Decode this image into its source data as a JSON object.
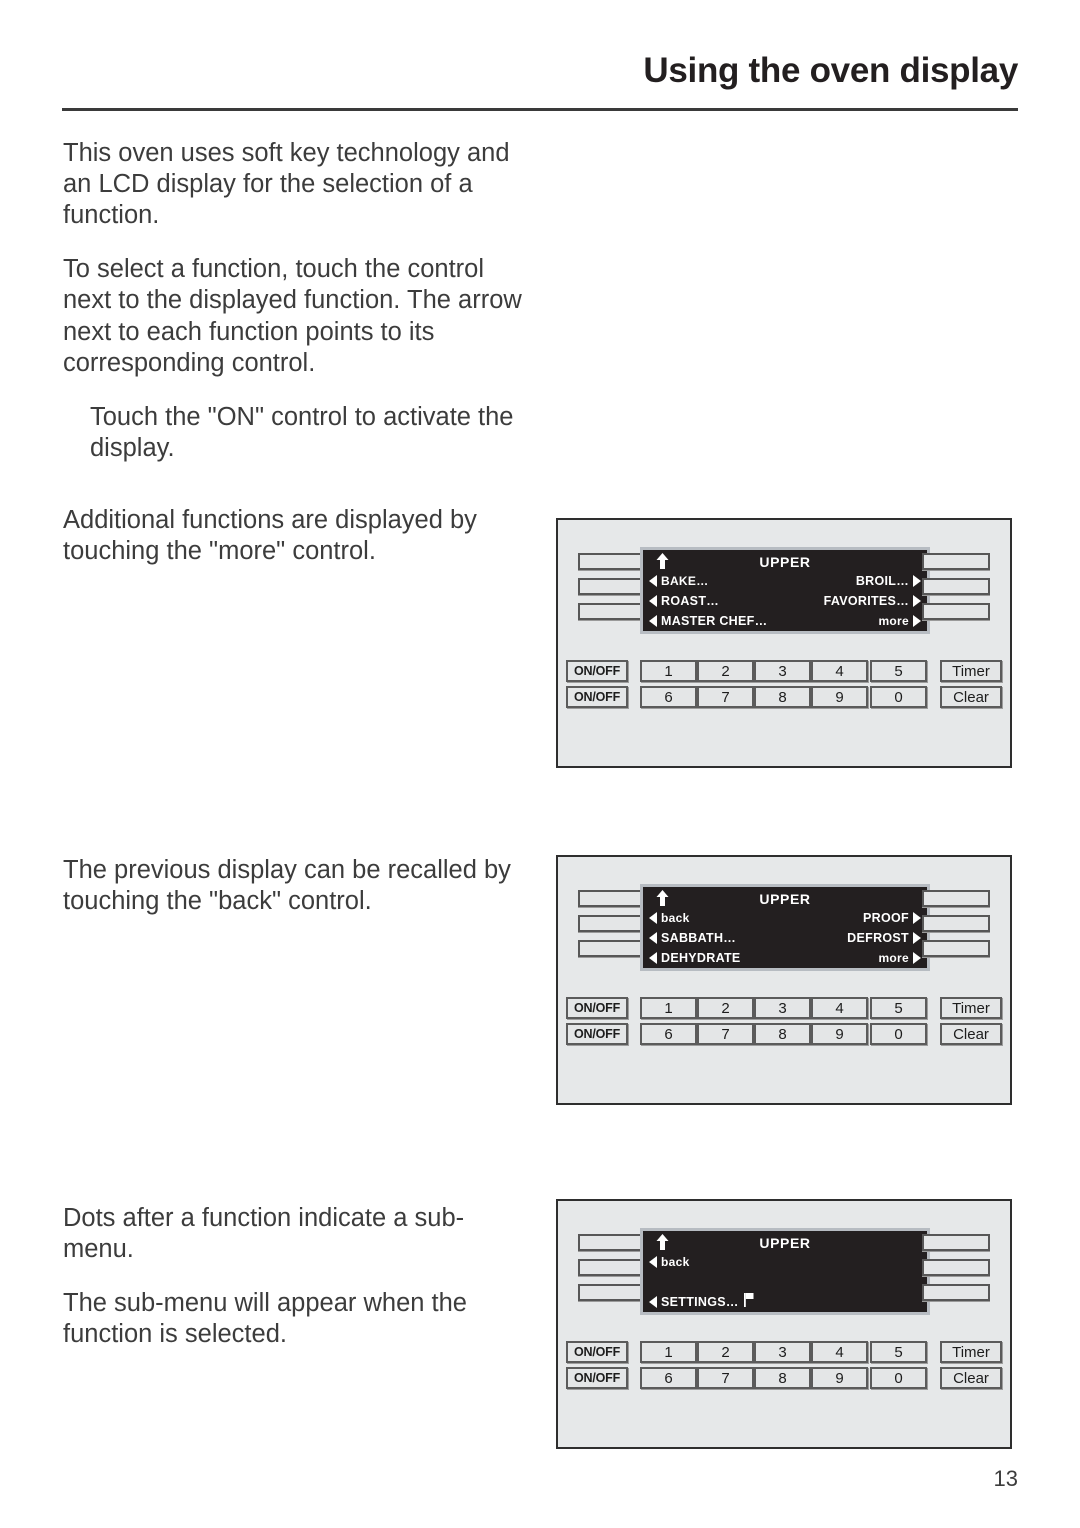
{
  "header": {
    "title": "Using the oven display"
  },
  "body": {
    "intro": [
      "This oven uses soft key technology and an LCD display for the selection of a function.",
      "To select a function, touch the control next to the displayed function. The arrow next to each function points to its corresponding control.",
      "Touch the \"ON\" control to activate the display."
    ],
    "more_note": [
      "Additional functions are displayed by touching the \"more\" control."
    ],
    "back_note": [
      "The previous display can be recalled by touching the \"back\" control."
    ],
    "dots_note": [
      "Dots after a function indicate a sub-menu.",
      "The sub-menu will appear when the function is selected."
    ]
  },
  "panels": [
    {
      "name": "panel-more",
      "lcd": {
        "title": "UPPER",
        "up_arrow_icon": "up-arrow-icon",
        "rows": [
          {
            "left": "BAKE…",
            "right": "BROIL…"
          },
          {
            "left": "ROAST…",
            "right": "FAVORITES…"
          },
          {
            "left": "MASTER CHEF…",
            "right": "more"
          }
        ]
      }
    },
    {
      "name": "panel-back",
      "lcd": {
        "title": "UPPER",
        "up_arrow_icon": "up-arrow-icon",
        "rows": [
          {
            "left": "back",
            "right": "PROOF"
          },
          {
            "left": "SABBATH…",
            "right": "DEFROST"
          },
          {
            "left": "DEHYDRATE",
            "right": "more"
          }
        ]
      }
    },
    {
      "name": "panel-settings",
      "lcd": {
        "title": "UPPER",
        "up_arrow_icon": "up-arrow-icon",
        "rows": [
          {
            "left": "back",
            "right": ""
          },
          {
            "left": "",
            "right": ""
          },
          {
            "left": "SETTINGS…",
            "right": "",
            "left_icon": "flag-icon"
          }
        ]
      }
    }
  ],
  "keypad": {
    "onoff_label": "ON/OFF",
    "timer_label": "Timer",
    "clear_label": "Clear",
    "row_top": [
      "1",
      "2",
      "3",
      "4",
      "5"
    ],
    "row_bottom": [
      "6",
      "7",
      "8",
      "9",
      "0"
    ]
  },
  "footer": {
    "page_number": "13"
  },
  "colors": {
    "lcd_background": "#231f20",
    "lcd_text": "#ffffff",
    "panel_background": "#e6e8e9",
    "panel_border": "#2e2e2e",
    "key_face": "#e4e6e7",
    "text": "#3c3c3c"
  }
}
